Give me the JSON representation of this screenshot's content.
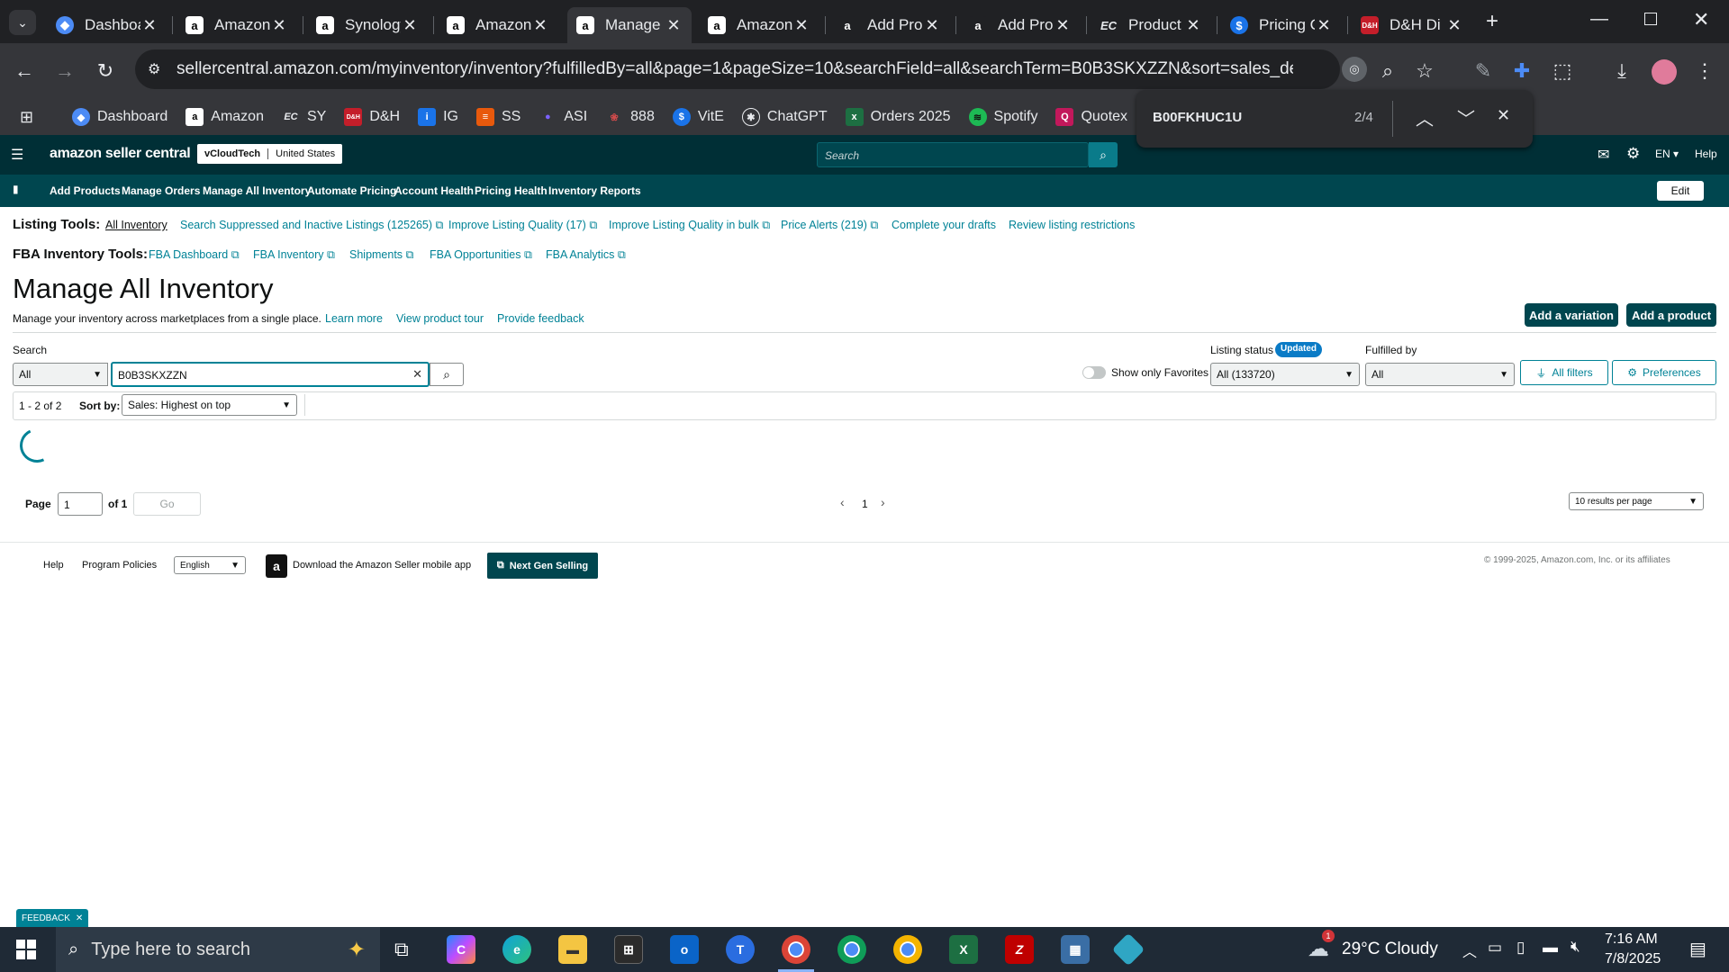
{
  "browser": {
    "tabs": [
      {
        "title": "Dashboard",
        "icon": "vine-icon",
        "active": false
      },
      {
        "title": "Amazon",
        "icon": "amazon-icon",
        "active": false
      },
      {
        "title": "Synology",
        "icon": "amazon-icon",
        "active": false
      },
      {
        "title": "Amazon",
        "icon": "amazon-icon",
        "active": false
      },
      {
        "title": "Manage",
        "icon": "amazon-icon",
        "active": true
      },
      {
        "title": "Amazon",
        "icon": "amazon-icon",
        "active": false
      },
      {
        "title": "Add Pro",
        "icon": "amazon-icon",
        "active": false
      },
      {
        "title": "Add Pro",
        "icon": "amazon-icon",
        "active": false
      },
      {
        "title": "Product",
        "icon": "ec-icon",
        "active": false
      },
      {
        "title": "Pricing C",
        "icon": "dollar-icon",
        "active": false
      },
      {
        "title": "D&H Di",
        "icon": "dh-icon",
        "active": false
      }
    ],
    "url": "sellercentral.amazon.com/myinventory/inventory?fulfilledBy=all&page=1&pageSize=10&searchField=all&searchTerm=B0B3SKXZZN&sort=sales_desc&status=all&r...",
    "bookmarks": [
      "Dashboard",
      "Amazon",
      "SY",
      "D&H",
      "IG",
      "SS",
      "ASI",
      "888",
      "VitE",
      "ChatGPT",
      "Orders 2025",
      "Spotify",
      "Quotex"
    ],
    "find": {
      "query": "B00FKHUC1U",
      "count": "2/4"
    }
  },
  "seller": {
    "logo": "amazon seller central",
    "account": "vCloudTech",
    "marketplace": "United States",
    "search_placeholder": "Search",
    "lang": "EN",
    "help": "Help",
    "nav": [
      "Add Products",
      "Manage Orders",
      "Manage All Inventory",
      "Automate Pricing",
      "Account Health",
      "Pricing Health",
      "Inventory Reports"
    ],
    "edit": "Edit"
  },
  "listing_tools": {
    "label": "Listing Tools:",
    "links": [
      "All Inventory",
      "Search Suppressed and Inactive Listings (125265)",
      "Improve Listing Quality (17)",
      "Improve Listing Quality in bulk",
      "Price Alerts (219)",
      "Complete your drafts",
      "Review listing restrictions"
    ]
  },
  "fba_tools": {
    "label": "FBA Inventory Tools:",
    "links": [
      "FBA Dashboard",
      "FBA Inventory",
      "Shipments",
      "FBA Opportunities",
      "FBA Analytics"
    ]
  },
  "page": {
    "title": "Manage All Inventory",
    "subtitle": "Manage your inventory across marketplaces from a single place.",
    "learn_more": "Learn more",
    "tour": "View product tour",
    "feedback": "Provide feedback",
    "add_variation": "Add a variation",
    "add_product": "Add a product"
  },
  "search": {
    "label": "Search",
    "field": "All",
    "term": "B0B3SKXZZN",
    "favorites": "Show only Favorites",
    "status_label": "Listing status",
    "status_badge": "Updated",
    "status_value": "All (133720)",
    "fulfilled_label": "Fulfilled by",
    "fulfilled_value": "All",
    "all_filters": "All filters",
    "preferences": "Preferences"
  },
  "results": {
    "range": "1 - 2 of 2",
    "sort_label": "Sort by:",
    "sort_value": "Sales: Highest on top"
  },
  "pagination": {
    "page_label": "Page",
    "page_value": "1",
    "of": "of 1",
    "go": "Go",
    "current": "1",
    "per_page": "10 results per page"
  },
  "footer": {
    "help": "Help",
    "policies": "Program Policies",
    "language": "English",
    "app": "Download the Amazon Seller mobile app",
    "next_gen": "Next Gen Selling",
    "copyright": "© 1999-2025, Amazon.com, Inc. or its affiliates",
    "feedback_tab": "FEEDBACK"
  },
  "taskbar": {
    "search_placeholder": "Type here to search",
    "weather": "29°C Cloudy",
    "time": "7:16 AM",
    "date": "7/8/2025",
    "notification_count": "1"
  },
  "colors": {
    "teal_dark": "#002f36",
    "teal": "#00464f",
    "link": "#008296",
    "badge": "#0a7bc6"
  }
}
